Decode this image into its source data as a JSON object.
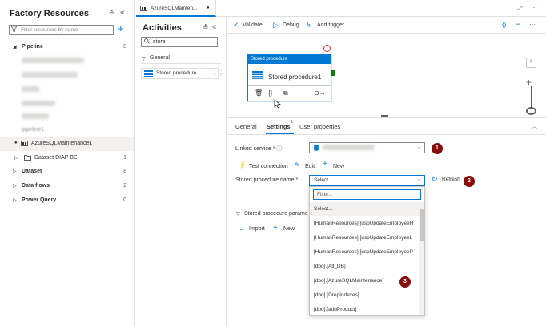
{
  "left_panel": {
    "title": "Factory Resources",
    "filter_placeholder": "Filter resources by name",
    "tree": [
      {
        "label": "Pipeline",
        "count": "8",
        "bold": true,
        "caret": "◢"
      },
      {
        "label": "pipeline1"
      },
      {
        "label": "AzureSQLMaintenance1"
      },
      {
        "label": "Dataset DIAP BE",
        "count": "1"
      },
      {
        "label": "Dataset",
        "count": "8",
        "bold": true
      },
      {
        "label": "Data flows",
        "count": "2",
        "bold": true
      },
      {
        "label": "Power Query",
        "count": "0",
        "bold": true
      }
    ]
  },
  "activities": {
    "title": "Activities",
    "search_value": "store",
    "group": "General",
    "item": "Stored procedure"
  },
  "tab": {
    "label": "AzureSQLMainten...",
    "dirty": "●"
  },
  "toolbar": {
    "validate": "Validate",
    "debug": "Debug",
    "add_trigger": "Add trigger"
  },
  "node": {
    "header": "Stored procedure",
    "label": "Stored procedure1"
  },
  "props_tabs": {
    "general": "General",
    "settings": "Settings",
    "settings_badge": "1",
    "user_properties": "User properties"
  },
  "settings": {
    "linked_service_label": "Linked service",
    "test_connection": "Test connection",
    "edit": "Edit",
    "new": "New",
    "sp_name_label": "Stored procedure name",
    "sp_name_value": "Select...",
    "refresh": "Refresh",
    "filter_placeholder": "Filter...",
    "options": [
      "Select...",
      "[HumanResources].[uspUpdateEmployeeH",
      "[HumanResources].[uspUpdateEmployeeL",
      "[HumanResources].[uspUpdateEmployeeP",
      "[dbo].[All_DB]",
      "[dbo].[AzureSQLMaintenance]",
      "[dbo].[DropIndexes]",
      "[dbo].[addProduct]"
    ],
    "sp_params_label": "Stored procedure parame",
    "import": "Import",
    "new2": "New"
  },
  "badges": [
    "1",
    "2",
    "3"
  ],
  "colors": {
    "accent": "#0078d4",
    "badge": "#8a0b0b",
    "node_header": "#0078d4"
  }
}
